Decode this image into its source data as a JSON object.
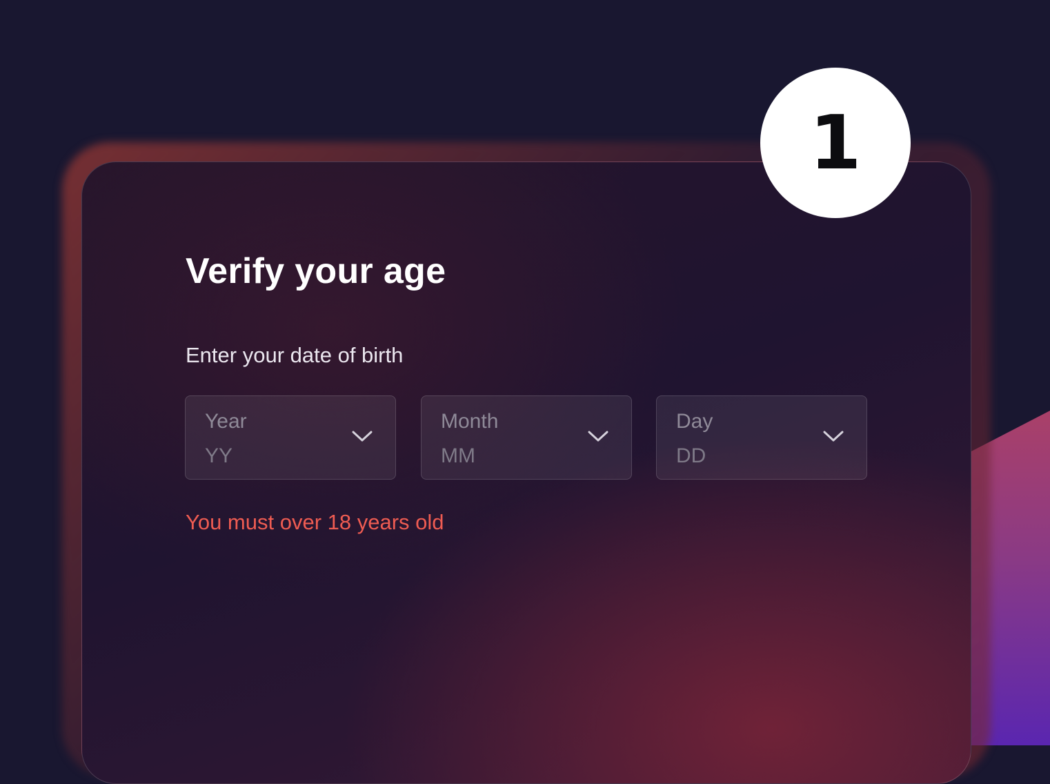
{
  "step_badge": "1",
  "form": {
    "title": "Verify your age",
    "subtitle": "Enter your date of birth",
    "fields": [
      {
        "label": "Year",
        "value": "YY",
        "icon": "chevron-down-icon"
      },
      {
        "label": "Month",
        "value": "MM",
        "icon": "chevron-down-icon"
      },
      {
        "label": "Day",
        "value": "DD",
        "icon": "chevron-down-icon"
      }
    ],
    "error": "You must over 18 years old"
  },
  "colors": {
    "background": "#191730",
    "error": "#ef5c52",
    "accent": "#f25b33"
  }
}
